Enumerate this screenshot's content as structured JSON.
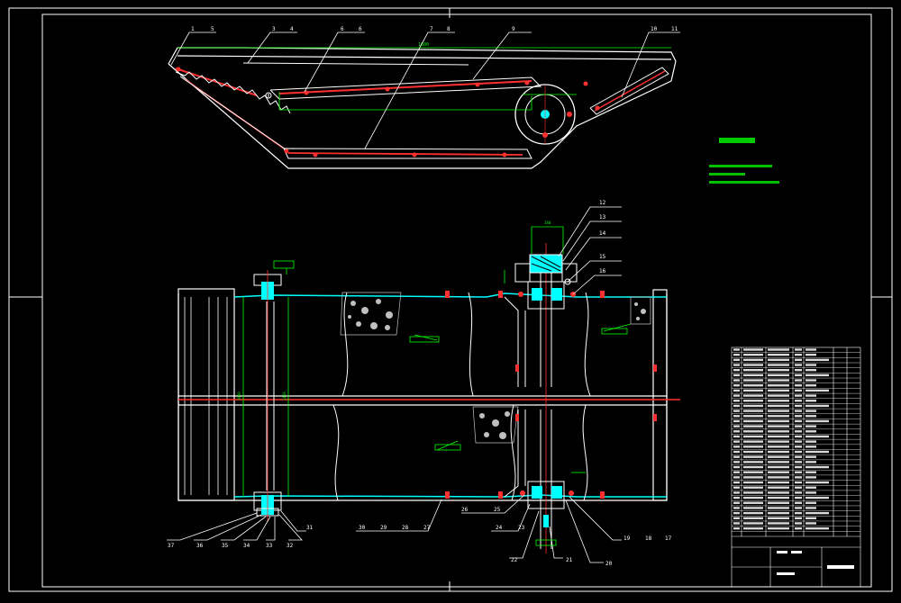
{
  "colors": {
    "background": "#000000",
    "frame": "#ffffff",
    "belt": "#00ffff",
    "axis": "#ff2020",
    "dimension": "#00ff00",
    "hatch": "#c0c0c0"
  },
  "top_view_callouts": [
    "1",
    "5",
    "3",
    "4",
    "6",
    "6",
    "7",
    "8",
    "9",
    "10",
    "11"
  ],
  "side_view_callouts_top": [
    "12",
    "13",
    "14",
    "15",
    "16"
  ],
  "side_view_callouts_bottom": [
    "37",
    "36",
    "35",
    "34",
    "33",
    "32",
    "31",
    "30",
    "29",
    "28",
    "27",
    "26",
    "25",
    "24",
    "23",
    "22",
    "21",
    "20",
    "19",
    "18",
    "17"
  ],
  "icons": [
    "hex-nut-icon",
    "bolt-icon",
    "drum-pulley-icon",
    "idler-roller-icon"
  ]
}
